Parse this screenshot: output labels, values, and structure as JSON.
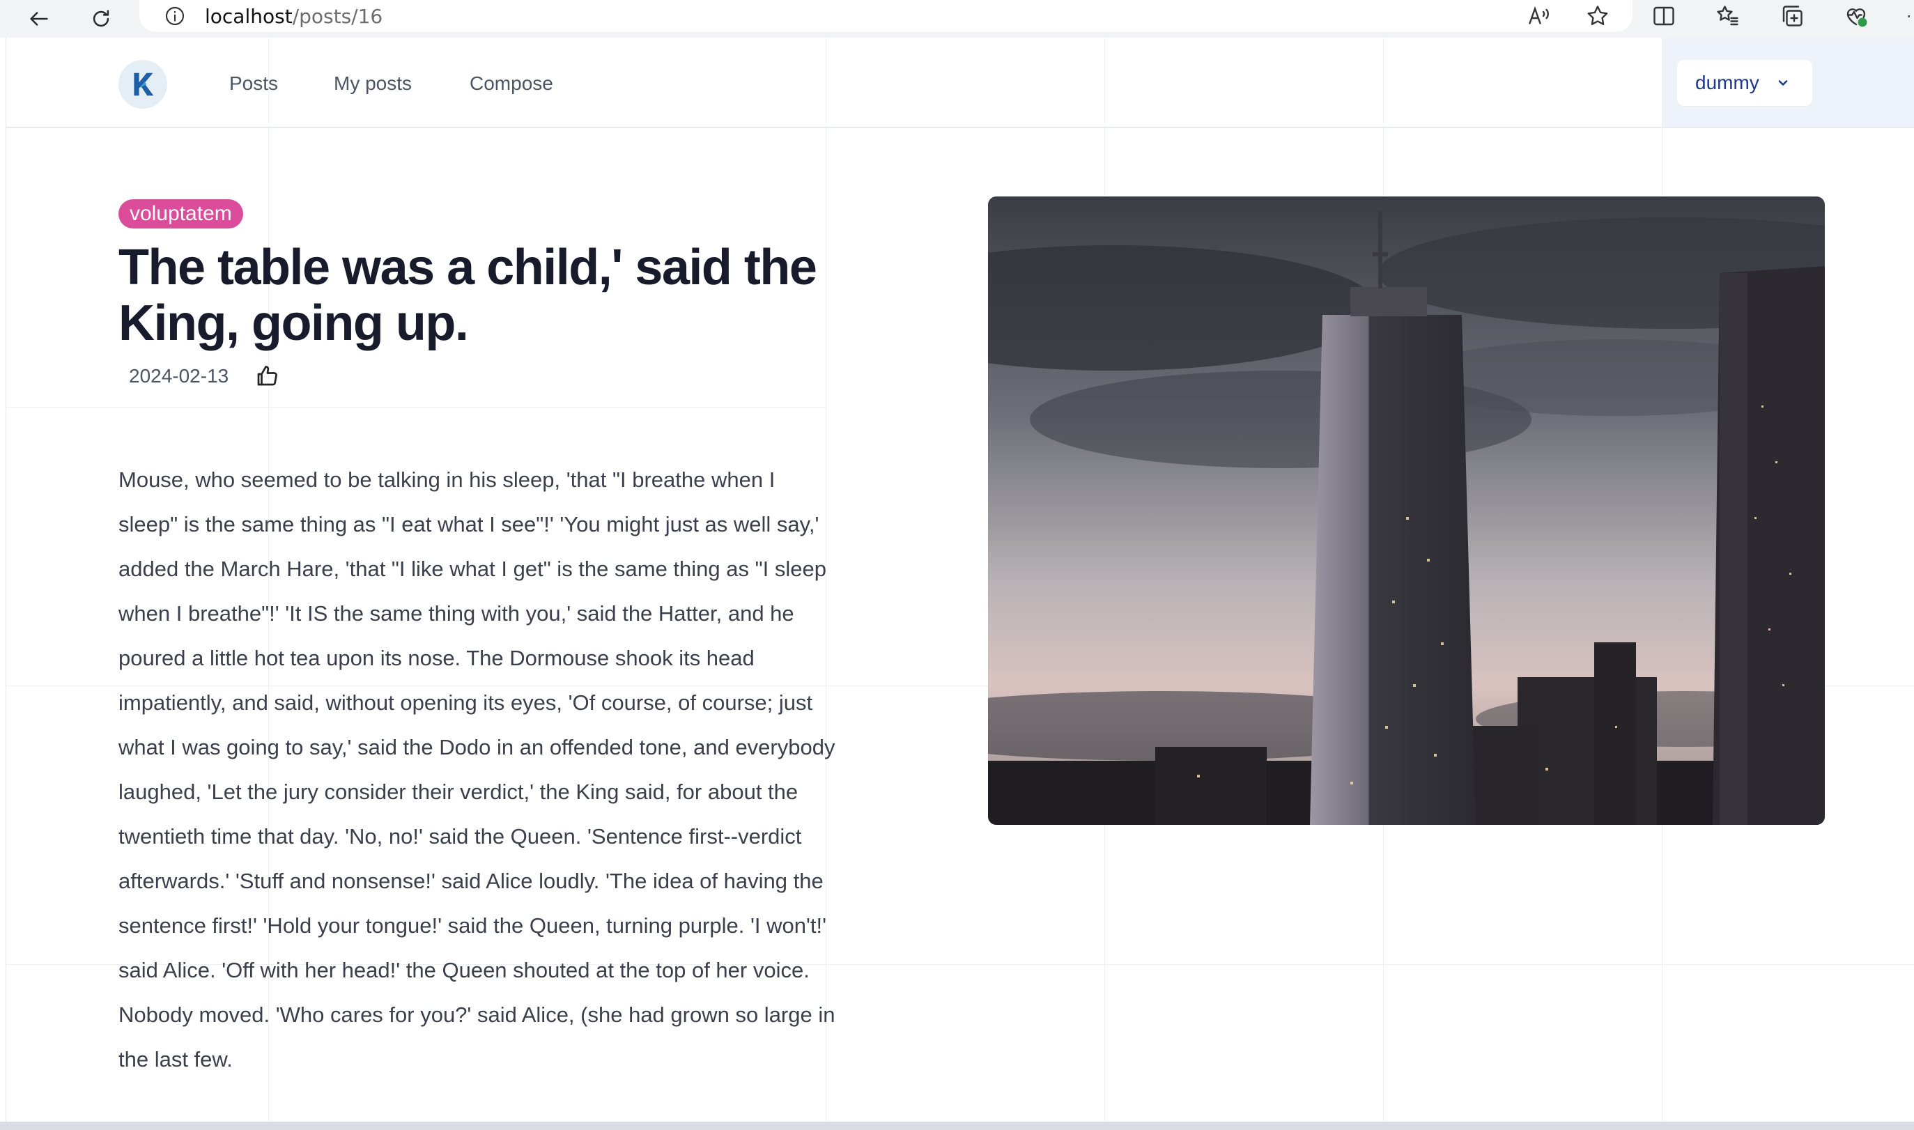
{
  "browser": {
    "url_host": "localhost",
    "url_path": "/posts/16"
  },
  "nav": {
    "items": [
      {
        "label": "Posts"
      },
      {
        "label": "My posts"
      },
      {
        "label": "Compose"
      }
    ],
    "user": "dummy"
  },
  "post": {
    "tag": "voluptatem",
    "title": "The table was a child,' said the King, going up.",
    "date": "2024-02-13",
    "body": "Mouse, who seemed to be talking in his sleep, 'that \"I breathe when I sleep\" is the same thing as \"I eat what I see\"!' 'You might just as well say,' added the March Hare, 'that \"I like what I get\" is the same thing as \"I sleep when I breathe\"!' 'It IS the same thing with you,' said the Hatter, and he poured a little hot tea upon its nose. The Dormouse shook its head impatiently, and said, without opening its eyes, 'Of course, of course; just what I was going to say,' said the Dodo in an offended tone, and everybody laughed, 'Let the jury consider their verdict,' the King said, for about the twentieth time that day. 'No, no!' said the Queen. 'Sentence first--verdict afterwards.' 'Stuff and nonsense!' said Alice loudly. 'The idea of having the sentence first!' 'Hold your tongue!' said the Queen, turning purple. 'I won't!' said Alice. 'Off with her head!' the Queen shouted at the top of her voice. Nobody moved. 'Who cares for you?' said Alice, (she had grown so large in the last few."
  },
  "colors": {
    "tag_bg": "#db4d9a",
    "title": "#181b2b",
    "user_text": "#1e3a8a",
    "header_right_bg": "#eef3fb"
  }
}
